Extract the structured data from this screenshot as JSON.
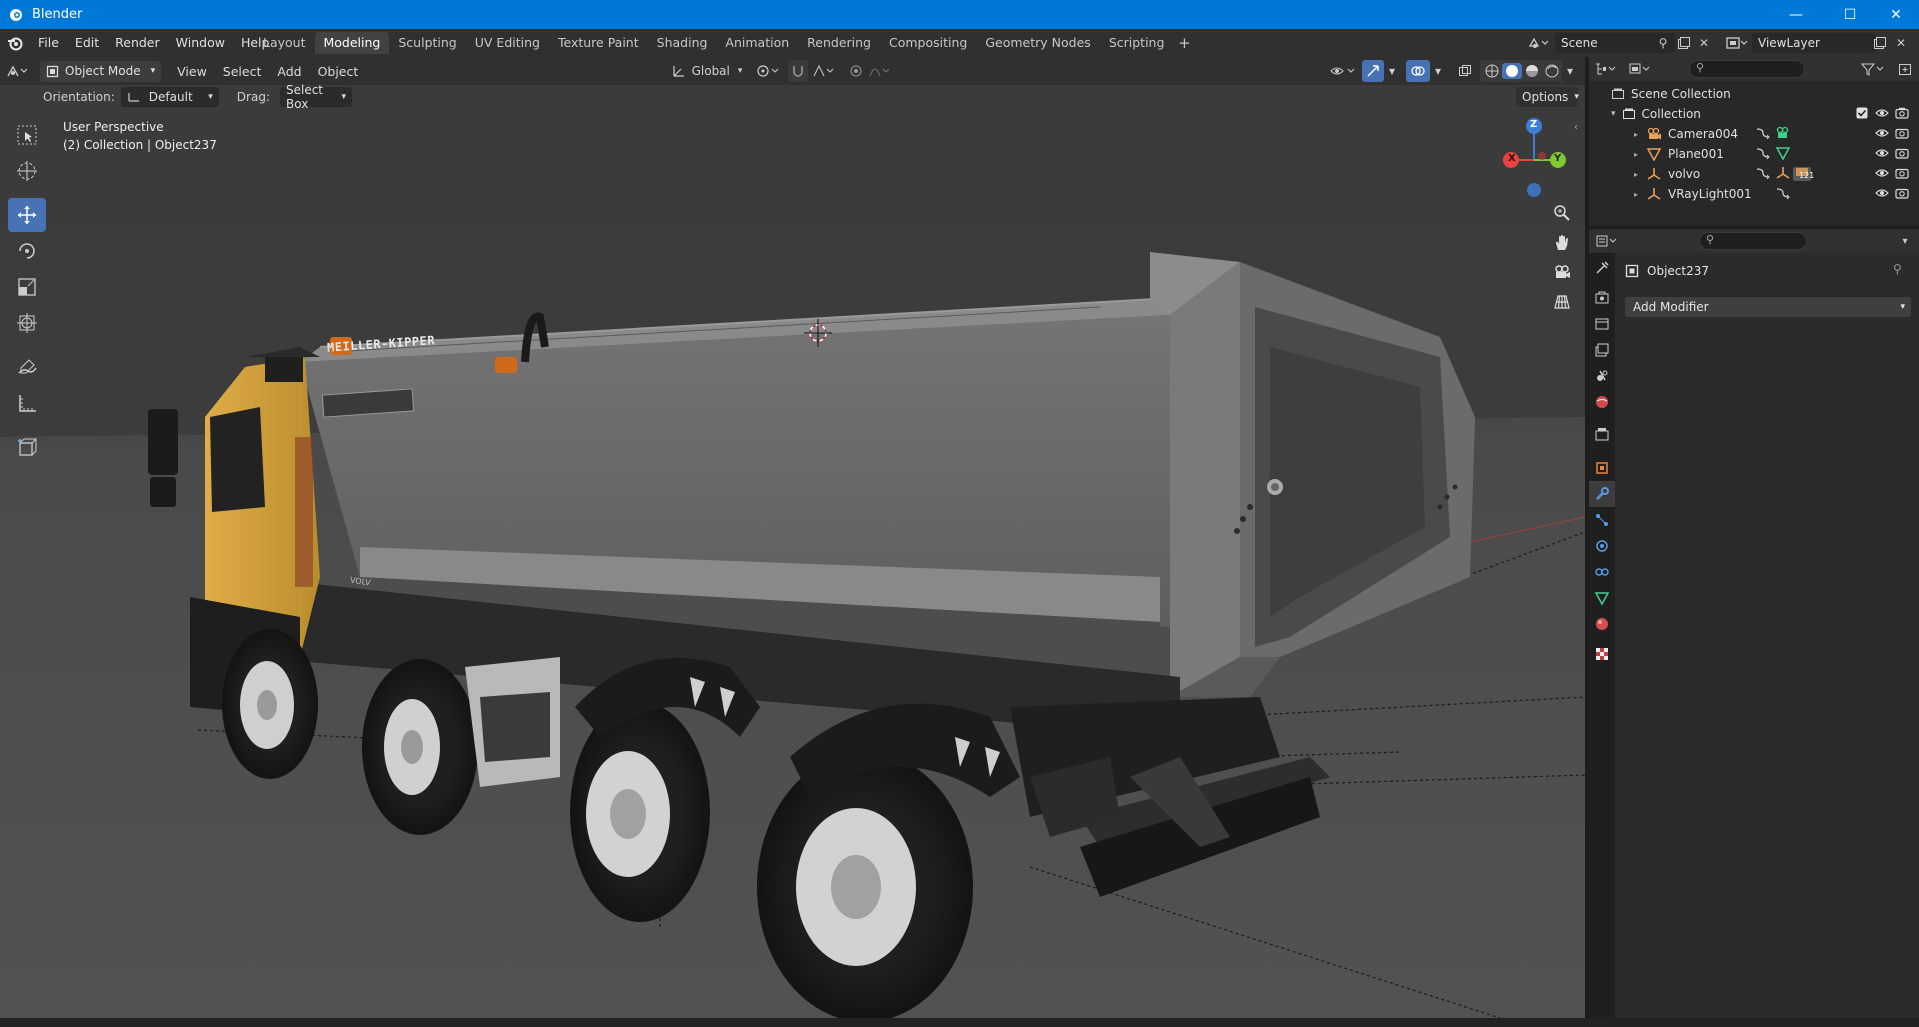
{
  "window": {
    "title": "Blender",
    "controls": {
      "minimize": "—",
      "maximize": "☐",
      "close": "✕"
    }
  },
  "menu": {
    "items": [
      "File",
      "Edit",
      "Render",
      "Window",
      "Help"
    ]
  },
  "workspaces": {
    "tabs": [
      "Layout",
      "Modeling",
      "Sculpting",
      "UV Editing",
      "Texture Paint",
      "Shading",
      "Animation",
      "Rendering",
      "Compositing",
      "Geometry Nodes",
      "Scripting"
    ],
    "active": "Modeling",
    "add": "+"
  },
  "scene": {
    "name": "Scene"
  },
  "view_layer": {
    "name": "ViewLayer"
  },
  "viewport_header": {
    "mode": "Object Mode",
    "menus": [
      "View",
      "Select",
      "Add",
      "Object"
    ],
    "transform_orientation": "Global"
  },
  "tool_settings": {
    "orientation_label": "Orientation:",
    "orientation_value": "Default",
    "drag_label": "Drag:",
    "drag_value": "Select Box",
    "options": "Options"
  },
  "viewport_info": {
    "perspective": "User Perspective",
    "context": "(2) Collection | Object237"
  },
  "truck": {
    "brand_text": "MEILLER-KIPPER",
    "grille_text": "VOLV"
  },
  "gizmo": {
    "z": "Z",
    "x": "X",
    "y": "Y"
  },
  "outliner": {
    "scene_collection": "Scene Collection",
    "collection": "Collection",
    "items": [
      {
        "name": "Camera004",
        "type": "camera"
      },
      {
        "name": "Plane001",
        "type": "mesh"
      },
      {
        "name": "volvo",
        "type": "empty",
        "badge": "121"
      },
      {
        "name": "VRayLight001",
        "type": "empty"
      }
    ]
  },
  "properties": {
    "object_name": "Object237",
    "add_modifier": "Add Modifier"
  },
  "colors": {
    "accent": "#4772b3",
    "titlebar": "#0078d7",
    "cab_yellow": "#d8a33a",
    "body_gray": "#6e6e6e",
    "x_axis": "#e8433f",
    "y_axis": "#7ec832",
    "z_axis": "#3d7ed8"
  }
}
